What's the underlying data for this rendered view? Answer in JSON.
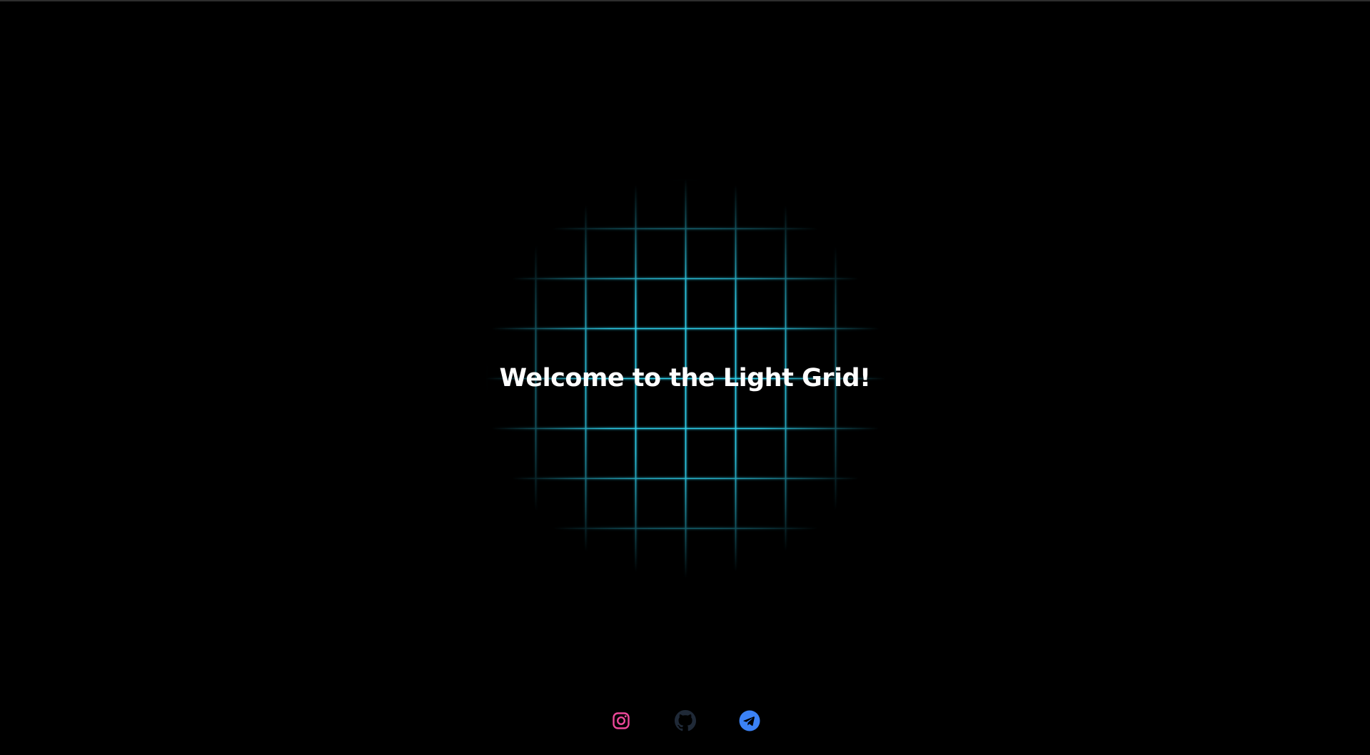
{
  "hero": {
    "title": "Welcome to the Light Grid!"
  },
  "grid": {
    "line_color": "#2ed3f0",
    "background": "#000000"
  },
  "socials": [
    {
      "name": "Instagram",
      "icon": "instagram-icon",
      "color": "#ec4899"
    },
    {
      "name": "GitHub",
      "icon": "github-icon",
      "color": "#1f2937"
    },
    {
      "name": "Telegram",
      "icon": "telegram-icon",
      "color": "#3b82f6"
    }
  ]
}
